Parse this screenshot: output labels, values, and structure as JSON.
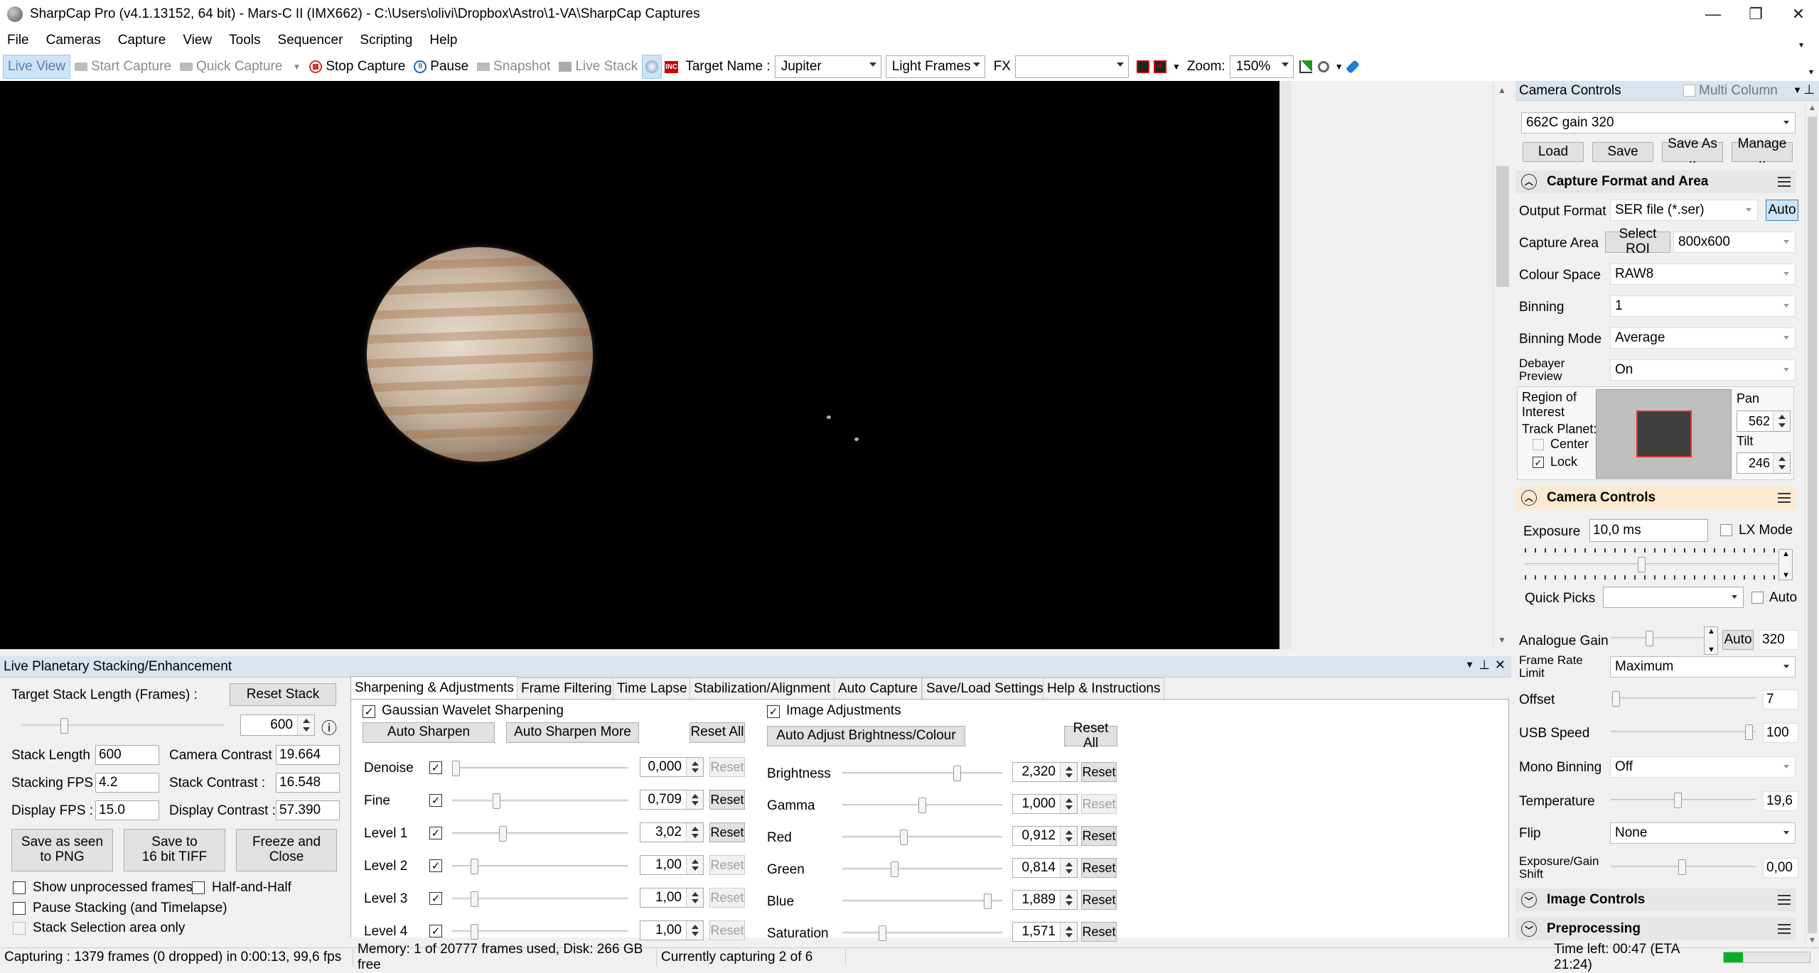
{
  "window": {
    "title": "SharpCap Pro (v4.1.13152, 64 bit) - Mars-C II (IMX662) - C:\\Users\\olivi\\Dropbox\\Astro\\1-VA\\SharpCap Captures",
    "minimize": "—",
    "restore": "❐",
    "close": "✕"
  },
  "menu": [
    "File",
    "Cameras",
    "Capture",
    "View",
    "Tools",
    "Sequencer",
    "Scripting",
    "Help"
  ],
  "toolbar": {
    "live_view": "Live View",
    "start_capture": "Start Capture",
    "quick_capture": "Quick Capture",
    "stop_capture": "Stop Capture",
    "pause": "Pause",
    "snapshot": "Snapshot",
    "live_stack": "Live Stack",
    "target_name_label": "Target Name :",
    "target_name": "Jupiter",
    "frame_type": "Light Frames",
    "fx_label": "FX",
    "fx_value": "",
    "zoom_label": "Zoom:",
    "zoom": "150%",
    "fov_label": "INC"
  },
  "stacking": {
    "header": "Live Planetary Stacking/Enhancement",
    "target_stack_label": "Target Stack Length (Frames) :",
    "reset_stack": "Reset Stack",
    "target_stack_value": "600",
    "target_stack_level": 0.2,
    "info_icon": "ⓘ",
    "stack_length_label": "Stack Length :",
    "stack_length": "600",
    "camera_contrast_label": "Camera Contrast :",
    "camera_contrast": "19.664",
    "stacking_fps_label": "Stacking FPS :",
    "stacking_fps": "4.2",
    "stack_contrast_label": "Stack Contrast :",
    "stack_contrast": "16.548",
    "display_fps_label": "Display FPS :",
    "display_fps": "15.0",
    "display_contrast_label": "Display Contrast :",
    "display_contrast": "57.390",
    "save_png": "Save as seen\nto PNG",
    "save_tiff": "Save to\n16 bit TIFF",
    "freeze_close": "Freeze and\nClose",
    "show_unprocessed": "Show unprocessed frames",
    "half_and_half": "Half-and-Half",
    "pause_stacking": "Pause Stacking (and Timelapse)",
    "stack_selection": "Stack Selection area only"
  },
  "tabs": [
    "Sharpening & Adjustments",
    "Frame Filtering",
    "Time Lapse",
    "Stabilization/Alignment",
    "Auto Capture",
    "Save/Load Settings",
    "Help & Instructions"
  ],
  "sharpening": {
    "title": "Gaussian Wavelet Sharpening",
    "auto_sharpen": "Auto Sharpen",
    "auto_sharpen_more": "Auto Sharpen More",
    "reset_all": "Reset All",
    "reset": "Reset",
    "rows": [
      {
        "label": "Denoise",
        "value": "0,000",
        "level": 0.0,
        "reset_enabled": false
      },
      {
        "label": "Fine",
        "value": "0,709",
        "level": 0.24,
        "reset_enabled": true
      },
      {
        "label": "Level 1",
        "value": "3,02",
        "level": 0.28,
        "reset_enabled": true
      },
      {
        "label": "Level 2",
        "value": "1,00",
        "level": 0.11,
        "reset_enabled": false
      },
      {
        "label": "Level 3",
        "value": "1,00",
        "level": 0.11,
        "reset_enabled": false
      },
      {
        "label": "Level 4",
        "value": "1,00",
        "level": 0.11,
        "reset_enabled": false
      }
    ]
  },
  "adjustments": {
    "title": "Image Adjustments",
    "auto_adjust": "Auto Adjust Brightness/Colour",
    "reset_all": "Reset All",
    "reset": "Reset",
    "rows": [
      {
        "label": "Brightness",
        "value": "2,320",
        "level": 0.73,
        "reset_enabled": true
      },
      {
        "label": "Gamma",
        "value": "1,000",
        "level": 0.5,
        "reset_enabled": false
      },
      {
        "label": "Red",
        "value": "0,912",
        "level": 0.38,
        "reset_enabled": true
      },
      {
        "label": "Green",
        "value": "0,814",
        "level": 0.32,
        "reset_enabled": true
      },
      {
        "label": "Blue",
        "value": "1,889",
        "level": 0.93,
        "reset_enabled": true
      },
      {
        "label": "Saturation",
        "value": "1,571",
        "level": 0.24,
        "reset_enabled": true
      }
    ]
  },
  "camera_controls": {
    "header": "Camera Controls",
    "multi_column": "Multi Column",
    "profile": "662C gain 320",
    "load": "Load",
    "save": "Save",
    "save_as": "Save As ..",
    "manage": "Manage ..",
    "capture_format_title": "Capture Format and Area",
    "output_format_label": "Output Format",
    "output_format": "SER file (*.ser)",
    "auto": "Auto",
    "capture_area_label": "Capture Area",
    "select_roi": "Select ROI",
    "capture_area": "800x600",
    "colour_space_label": "Colour Space",
    "colour_space": "RAW8",
    "binning_label": "Binning",
    "binning": "1",
    "binning_mode_label": "Binning Mode",
    "binning_mode": "Average",
    "debayer_label": "Debayer\nPreview",
    "debayer": "On",
    "roi_label": "Region of\nInterest",
    "track_planet_label": "Track Planet:",
    "center_label": "Center",
    "lock_label": "Lock",
    "pan_label": "Pan",
    "pan": "562",
    "tilt_label": "Tilt",
    "tilt": "246",
    "camera_controls_title": "Camera Controls",
    "exposure_label": "Exposure",
    "exposure": "10,0 ms",
    "exposure_level": 0.46,
    "lx_mode": "LX Mode",
    "quick_picks_label": "Quick Picks",
    "quick_picks": "",
    "quick_auto": "Auto",
    "analogue_gain_label": "Analogue Gain",
    "analogue_gain_auto": "Auto",
    "analogue_gain": "320",
    "analogue_gain_level": 0.41,
    "frame_rate_label": "Frame Rate\nLimit",
    "frame_rate": "Maximum",
    "offset_label": "Offset",
    "offset": "7",
    "offset_level": 0.01,
    "usb_speed_label": "USB Speed",
    "usb_speed": "100",
    "usb_speed_level": 0.98,
    "mono_binning_label": "Mono Binning",
    "mono_binning": "Off",
    "temperature_label": "Temperature",
    "temperature": "19,6",
    "temperature_level": 0.46,
    "flip_label": "Flip",
    "flip": "None",
    "exp_gain_shift_label": "Exposure/Gain\nShift",
    "exp_gain_shift": "0,00",
    "exp_gain_shift_level": 0.49,
    "image_controls_title": "Image Controls",
    "preprocessing_title": "Preprocessing"
  },
  "status": {
    "capturing": "Capturing : 1379 frames (0 dropped) in 0:00:13, 99,6 fps",
    "memory": "Memory: 1 of 20777 frames used, Disk: 266 GB free",
    "currently": "Currently capturing 2 of 6",
    "time_left": "Time left: 00:47 (ETA 21:24)"
  },
  "colors": {
    "accent_selection": "#cde4f7",
    "panel_header": "#dfe6ee",
    "camera_section_header": "#fbe9d0",
    "stop_red": "#d33",
    "progress_green": "#06b025"
  }
}
